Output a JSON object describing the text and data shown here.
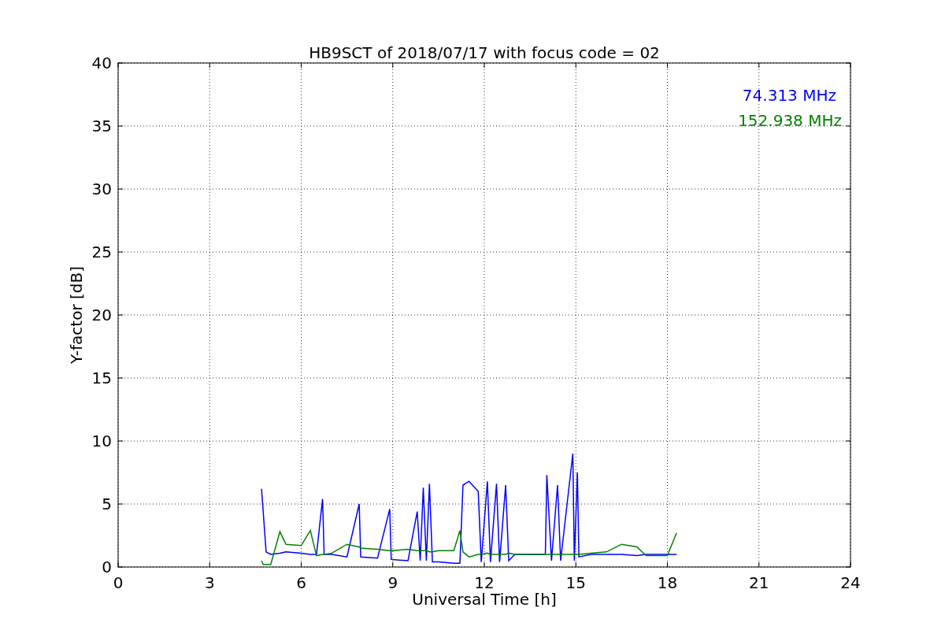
{
  "chart_data": {
    "type": "line",
    "title": "HB9SCT of 2018/07/17 with focus code = 02",
    "xlabel": "Universal Time [h]",
    "ylabel": "Y-factor [dB]",
    "x": [
      4.7,
      4.75,
      4.85,
      5.0,
      5.3,
      5.5,
      6.0,
      6.3,
      6.5,
      6.7,
      6.75,
      7.0,
      7.5,
      7.9,
      7.95,
      8.5,
      8.9,
      8.95,
      9.5,
      9.8,
      9.9,
      10.0,
      10.1,
      10.2,
      10.3,
      10.5,
      11.0,
      11.2,
      11.3,
      11.5,
      11.8,
      11.9,
      12.1,
      12.2,
      12.4,
      12.5,
      12.7,
      12.8,
      13.0,
      14.0,
      14.05,
      14.2,
      14.4,
      14.5,
      14.9,
      14.95,
      15.05,
      15.1,
      15.5,
      16.0,
      16.5,
      17.0,
      17.3,
      18.0,
      18.3
    ],
    "series": [
      {
        "name": "74.313 MHz",
        "color": "#0000ff",
        "values": [
          6.2,
          4.5,
          1.2,
          1.0,
          1.1,
          1.2,
          1.1,
          1.0,
          1.0,
          5.4,
          1.0,
          1.0,
          0.8,
          5.0,
          0.8,
          0.7,
          4.6,
          0.6,
          0.5,
          4.4,
          0.5,
          6.3,
          0.5,
          6.6,
          0.4,
          0.4,
          0.3,
          0.3,
          6.5,
          6.8,
          6.0,
          0.4,
          6.8,
          0.4,
          6.6,
          0.4,
          6.5,
          0.5,
          1.0,
          1.0,
          7.3,
          0.5,
          6.5,
          0.5,
          9.0,
          0.5,
          7.5,
          0.8,
          1.0,
          1.0,
          1.0,
          0.9,
          1.0,
          1.0,
          1.0
        ]
      },
      {
        "name": "152.938 MHz",
        "color": "#008000",
        "values": [
          0.5,
          0.2,
          0.2,
          0.2,
          2.8,
          1.8,
          1.7,
          2.9,
          0.9,
          1.0,
          1.0,
          1.1,
          1.8,
          1.6,
          1.5,
          1.4,
          1.3,
          1.3,
          1.4,
          1.3,
          1.3,
          1.3,
          1.3,
          1.2,
          1.2,
          1.3,
          1.3,
          2.9,
          1.2,
          0.8,
          1.0,
          1.0,
          1.1,
          1.0,
          1.0,
          1.0,
          1.0,
          1.1,
          1.0,
          1.0,
          1.0,
          1.0,
          1.0,
          1.0,
          1.0,
          1.0,
          1.0,
          1.0,
          1.1,
          1.2,
          1.8,
          1.6,
          0.9,
          0.9,
          2.7
        ]
      }
    ],
    "grid": true,
    "xlim": [
      0,
      24
    ],
    "ylim": [
      0,
      40
    ],
    "xticks": [
      0,
      3,
      6,
      9,
      12,
      15,
      18,
      21,
      24
    ],
    "yticks": [
      0,
      5,
      10,
      15,
      20,
      25,
      30,
      35,
      40
    ]
  }
}
